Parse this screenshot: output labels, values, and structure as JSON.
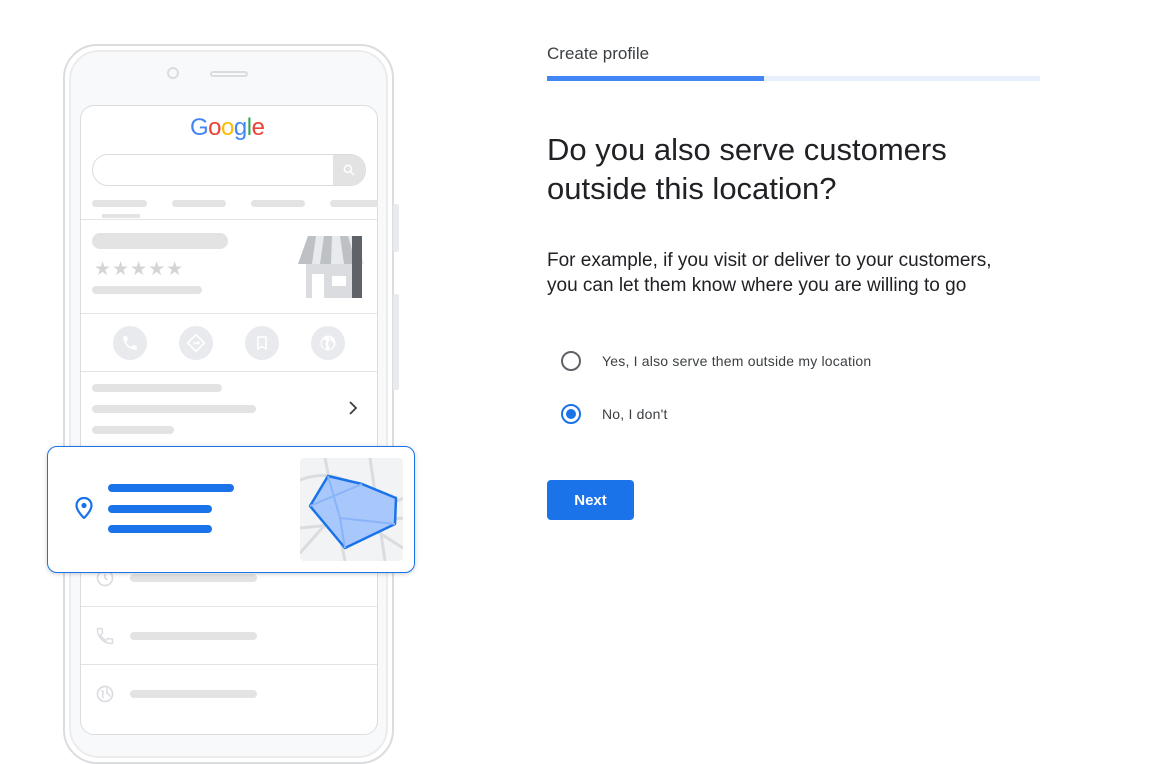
{
  "illustration": {
    "google_logo": {
      "letters": [
        "G",
        "o",
        "o",
        "g",
        "l",
        "e"
      ],
      "colors": [
        "#4285F4",
        "#EA4335",
        "#FBBC05",
        "#4285F4",
        "#34A853",
        "#EA4335"
      ]
    },
    "stars": "★★★★★"
  },
  "form": {
    "step_label": "Create profile",
    "progress_fraction": 0.44,
    "headline_line1": "Do you also serve customers",
    "headline_line2": "outside this location?",
    "subtext_line1": "For example, if you visit or deliver to your customers,",
    "subtext_line2": "you can let them know where you are willing to go",
    "options": [
      {
        "label": "Yes, I also serve them outside my location",
        "selected": false
      },
      {
        "label": "No, I don't",
        "selected": true
      }
    ],
    "next_label": "Next"
  },
  "colors": {
    "accent": "#1a73e8",
    "progress": "#4285f4",
    "map_area": "#a8c7fa"
  }
}
